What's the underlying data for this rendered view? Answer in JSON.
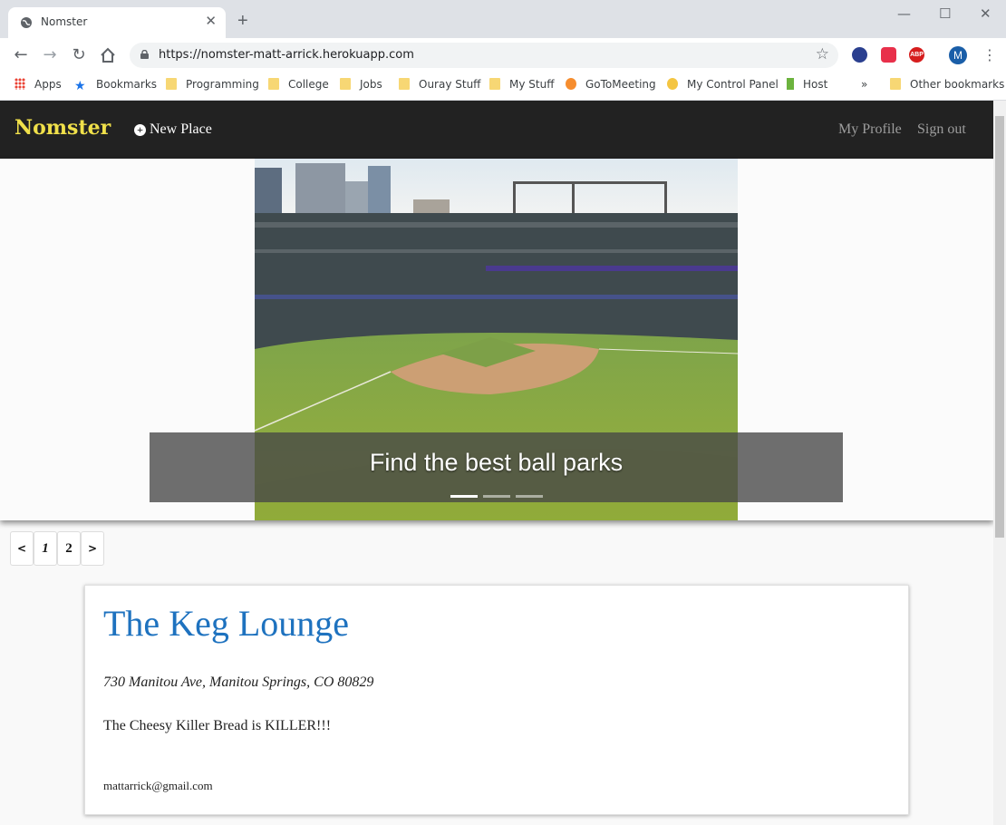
{
  "browser": {
    "tab_title": "Nomster",
    "url": "https://nomster-matt-arrick.herokuapp.com",
    "profile_initial": "M",
    "bookmarks": [
      "Apps",
      "Bookmarks",
      "Programming",
      "College",
      "Jobs",
      "Ouray Stuff",
      "My Stuff",
      "GoToMeeting",
      "My Control Panel",
      "Host"
    ],
    "more_bookmarks_label": "»",
    "other_bookmarks": "Other bookmarks"
  },
  "site_nav": {
    "brand": "Nomster",
    "new_place": "New Place",
    "my_profile": "My Profile",
    "sign_out": "Sign out"
  },
  "carousel": {
    "caption": "Find the best ball parks",
    "slide_count": 3,
    "active_slide": 1
  },
  "pagination": {
    "prev": "<",
    "pages": [
      "1",
      "2"
    ],
    "next": ">"
  },
  "place": {
    "name": "The Keg Lounge",
    "address": "730 Manitou Ave, Manitou Springs, CO 80829",
    "description": "The Cheesy Killer Bread is KILLER!!!",
    "user_email": "mattarrick@gmail.com"
  },
  "colors": {
    "brand": "#f0e04a",
    "navbar": "#222222",
    "title_link": "#1e72bf"
  }
}
